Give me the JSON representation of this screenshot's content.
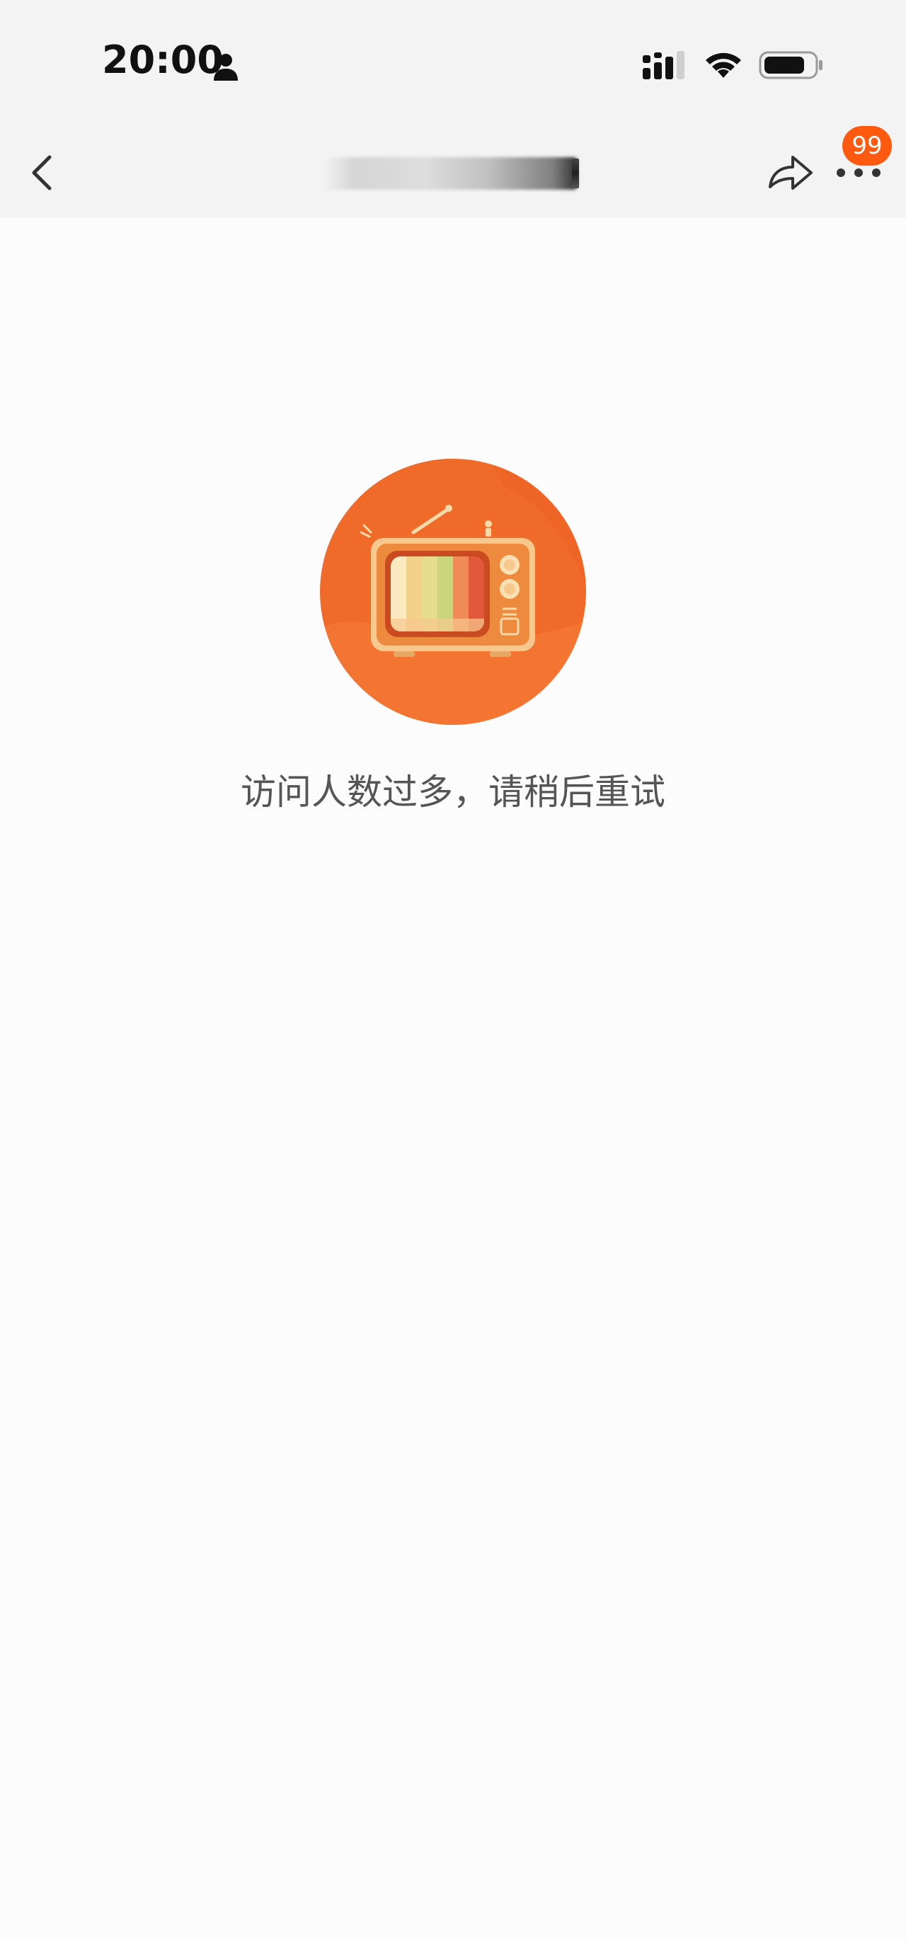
{
  "status_bar": {
    "time": "20:00",
    "person_icon": "person-icon",
    "signal_icon": "cellular-signal-icon",
    "wifi_icon": "wifi-icon",
    "battery_icon": "battery-icon"
  },
  "nav": {
    "back_icon": "chevron-left-icon",
    "share_icon": "share-icon",
    "more_icon": "more-dots-icon",
    "badge_count": "99"
  },
  "error": {
    "illustration": "tv-illustration",
    "message": "访问人数过多，请稍后重试"
  },
  "colors": {
    "accent": "#ff5a0f",
    "illustration_orange": "#f06a2a",
    "background": "#fcfcfc",
    "topbar": "#f3f3f3"
  }
}
